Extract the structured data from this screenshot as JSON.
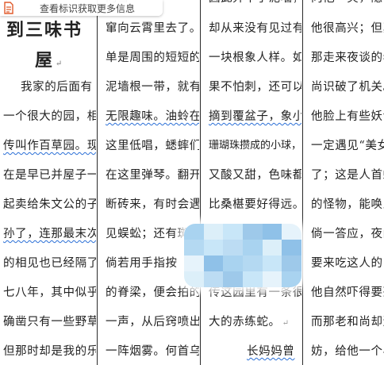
{
  "toolbar": {
    "icon": "document-icon",
    "label": "查看标识获取更多信息"
  },
  "title": {
    "line1": "到三味书",
    "line2": "屋",
    "mark": "↵"
  },
  "columns": [
    {
      "lines": [
        "我家的后面有",
        "一个很大的园，相",
        "传叫作百草园。现",
        "在是早已并屋子一",
        "起卖给朱文公的子",
        "孙了，连那最末次",
        "的相见也已经隔了",
        "七八年，其中似乎",
        "确凿只有一些野草；",
        "但那时却是我的乐"
      ]
    },
    {
      "lines": [
        "窜向云霄里去了。",
        "单是周围的短短的",
        "泥墙根一带，就有",
        "无限趣味。油蛉在",
        "这里低唱，蟋蟀们",
        "在这里弹琴。翻开",
        "断砖来，有时会遇",
        "见蜈蚣；还有斑蝥，",
        "倘若用手指按",
        "的脊梁，便会拍的",
        "一声，从后窍喷出",
        "一阵烟雾。何首乌"
      ]
    },
    {
      "lines": [
        "却从来没有见过有",
        "一块根象人样。如",
        "果不怕刺，还可以",
        "摘到覆盆子，象小",
        "珊瑚珠攒成的小球，",
        "又酸又甜，色味都",
        "比桑椹要好得远。",
        "",
        "传这园里有一条很",
        "大的赤练蛇。",
        "长妈妈曾"
      ],
      "marks": {
        "line7": "↵",
        "line10": "↵"
      }
    },
    {
      "lines": [
        "他很高兴；但真",
        "那走来夜谈的老",
        "尚识破了机关。",
        "他脸上有些妖气",
        "一定遇见“美女蛇",
        "了；这是人首蛇",
        "的怪物，能唤人名",
        "倘一答应，夜间",
        "要来吃这人的肉",
        "他自然吓得要死",
        "而那老和尚却道",
        "妨，给他一个小"
      ]
    }
  ],
  "fragments": {
    "top_col2": "向雪",
    "top_col3": "因此弄中了泥墙，",
    "top_col4": "向他一笑，隐么"
  },
  "colors": {
    "text": "#222222",
    "rule": "#2a2a2a",
    "spellcheck": "#2a6fd6",
    "mosaic": [
      "#a9d3f0",
      "#c8e6f8",
      "#8fc1e8",
      "#dceff9",
      "#b4d9f2",
      "#9ec9ea",
      "#e6f3fb",
      "#bcdcf3"
    ]
  }
}
